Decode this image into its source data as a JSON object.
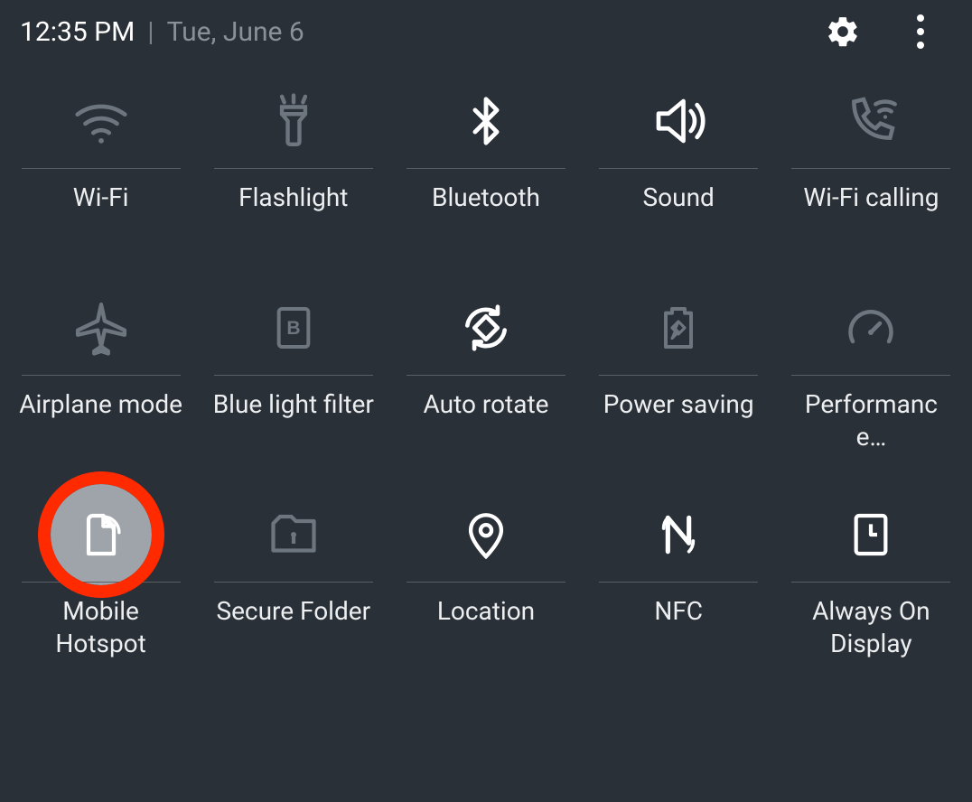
{
  "header": {
    "time": "12:35 PM",
    "date": "Tue, June 6"
  },
  "tiles": [
    {
      "id": "wifi",
      "label": "Wi-Fi",
      "active": false,
      "highlighted": false
    },
    {
      "id": "flashlight",
      "label": "Flashlight",
      "active": false,
      "highlighted": false
    },
    {
      "id": "bluetooth",
      "label": "Bluetooth",
      "active": true,
      "highlighted": false
    },
    {
      "id": "sound",
      "label": "Sound",
      "active": true,
      "highlighted": false
    },
    {
      "id": "wifi-calling",
      "label": "Wi-Fi calling",
      "active": false,
      "highlighted": false
    },
    {
      "id": "airplane",
      "label": "Airplane mode",
      "active": false,
      "highlighted": false
    },
    {
      "id": "bluelight",
      "label": "Blue light filter",
      "active": false,
      "highlighted": false
    },
    {
      "id": "autorotate",
      "label": "Auto rotate",
      "active": true,
      "highlighted": false
    },
    {
      "id": "powersaving",
      "label": "Power saving",
      "active": false,
      "highlighted": false
    },
    {
      "id": "performance",
      "label": "Performanc e…",
      "active": false,
      "highlighted": false
    },
    {
      "id": "hotspot",
      "label": "Mobile Hotspot",
      "active": true,
      "highlighted": true
    },
    {
      "id": "securefolder",
      "label": "Secure Folder",
      "active": false,
      "highlighted": false
    },
    {
      "id": "location",
      "label": "Location",
      "active": true,
      "highlighted": false
    },
    {
      "id": "nfc",
      "label": "NFC",
      "active": true,
      "highlighted": false
    },
    {
      "id": "aod",
      "label": "Always On Display",
      "active": true,
      "highlighted": false
    }
  ]
}
